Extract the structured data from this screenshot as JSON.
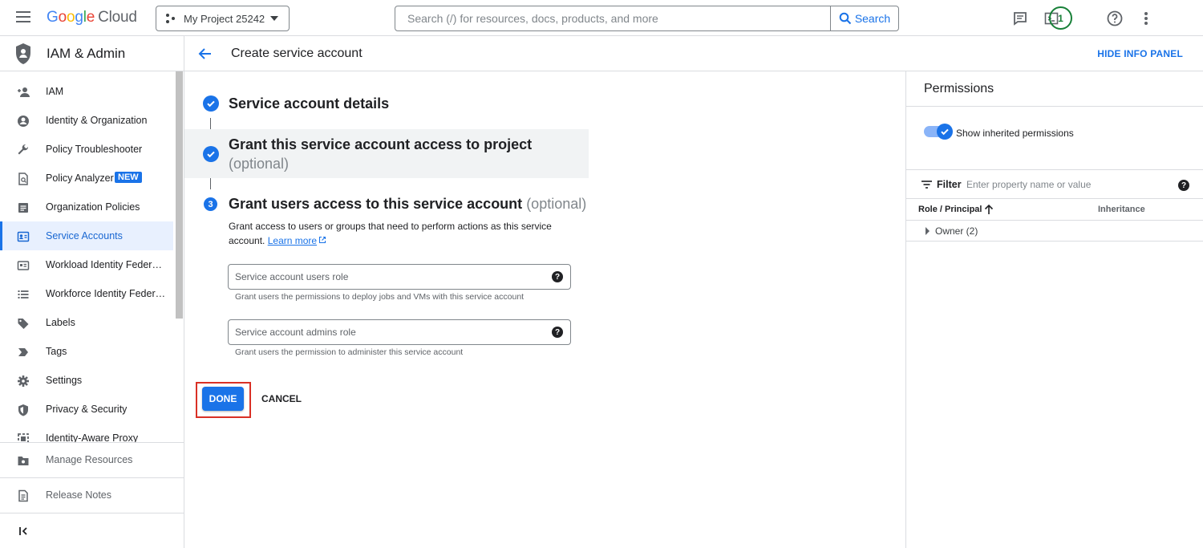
{
  "topbar": {
    "logo_letters": [
      "G",
      "o",
      "o",
      "g",
      "l",
      "e"
    ],
    "logo_suffix": "Cloud",
    "project_name": "My Project 25242",
    "search_placeholder": "Search (/) for resources, docs, products, and more",
    "search_button": "Search",
    "notification_count": "1"
  },
  "sidebar": {
    "title": "IAM & Admin",
    "items": [
      {
        "label": "IAM",
        "icon": "person-add-icon"
      },
      {
        "label": "Identity & Organization",
        "icon": "account-circle-icon"
      },
      {
        "label": "Policy Troubleshooter",
        "icon": "wrench-icon"
      },
      {
        "label": "Policy Analyzer",
        "icon": "document-search-icon",
        "badge": "NEW"
      },
      {
        "label": "Organization Policies",
        "icon": "list-box-icon"
      },
      {
        "label": "Service Accounts",
        "icon": "service-account-icon",
        "active": true
      },
      {
        "label": "Workload Identity Federati...",
        "icon": "id-card-icon"
      },
      {
        "label": "Workforce Identity Federa...",
        "icon": "list-icon"
      },
      {
        "label": "Labels",
        "icon": "label-tag-icon"
      },
      {
        "label": "Tags",
        "icon": "tag-chevron-icon"
      },
      {
        "label": "Settings",
        "icon": "gear-icon"
      },
      {
        "label": "Privacy & Security",
        "icon": "shield-icon"
      },
      {
        "label": "Identity-Aware Proxy",
        "icon": "proxy-icon"
      }
    ],
    "footer": [
      {
        "label": "Manage Resources",
        "icon": "folder-gear-icon"
      },
      {
        "label": "Release Notes",
        "icon": "notes-icon"
      }
    ],
    "collapse_icon": "collapse-left-icon"
  },
  "page": {
    "title": "Create service account",
    "hide_info_panel": "HIDE INFO PANEL"
  },
  "steps": {
    "step1": {
      "title": "Service account details"
    },
    "step2": {
      "title": "Grant this service account access to project",
      "optional": "(optional)"
    },
    "step3": {
      "number": "3",
      "title": "Grant users access to this service account",
      "optional": "(optional)",
      "description": "Grant access to users or groups that need to perform actions as this service account.",
      "learn_more": "Learn more",
      "users_role_placeholder": "Service account users role",
      "users_role_hint": "Grant users the permissions to deploy jobs and VMs with this service account",
      "admins_role_placeholder": "Service account admins role",
      "admins_role_hint": "Grant users the permission to administer this service account"
    }
  },
  "actions": {
    "done": "DONE",
    "cancel": "CANCEL"
  },
  "info_panel": {
    "title": "Permissions",
    "toggle_label": "Show inherited permissions",
    "toggle_on": true,
    "filter_label": "Filter",
    "filter_placeholder": "Enter property name or value",
    "col_role": "Role / Principal",
    "col_inheritance": "Inheritance",
    "rows": [
      {
        "label": "Owner (2)"
      }
    ]
  },
  "colors": {
    "accent": "#1a73e8",
    "highlight": "#d93025"
  }
}
